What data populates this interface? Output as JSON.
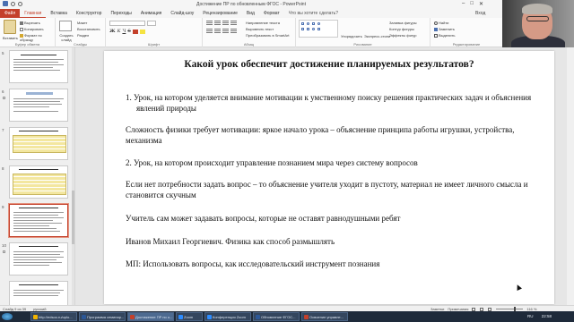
{
  "window": {
    "title": "Достижение ПР по обновленным ФГОС  -  PowerPoint",
    "controls": [
      "–",
      "□",
      "✕"
    ]
  },
  "tabs": {
    "items": [
      "Файл",
      "Главная",
      "Вставка",
      "Конструктор",
      "Переходы",
      "Анимация",
      "Слайд-шоу",
      "Рецензирование",
      "Вид",
      "Формат"
    ],
    "tell_me": "Что вы хотите сделать?",
    "login": "Вход"
  },
  "ribbon": {
    "clipboard": {
      "paste": "Вставить",
      "cut": "Вырезать",
      "copy": "Копировать",
      "format": "Формат по образцу",
      "label": "Буфер обмена"
    },
    "slides": {
      "new_slide": "Создать слайд",
      "layout": "Макет",
      "reset": "Восстановить",
      "section": "Раздел",
      "label": "Слайды"
    },
    "font": {
      "bold": "Ж",
      "italic": "К",
      "underline": "Ч",
      "strike": "S",
      "label": "Шрифт"
    },
    "paragraph": {
      "text_direction": "Направление текста",
      "align_text": "Выровнять текст",
      "smartart": "Преобразовать в SmartArt",
      "label": "Абзац"
    },
    "drawing": {
      "arrange": "Упорядочить",
      "quick_styles": "Экспресс-стили",
      "fill": "Заливка фигуры",
      "outline": "Контур фигуры",
      "effects": "Эффекты фигур",
      "label": "Рисование"
    },
    "editing": {
      "find": "Найти",
      "replace": "Заменить",
      "select": "Выделить",
      "label": "Редактирование"
    }
  },
  "thumbnails": {
    "numbers": [
      "5",
      "6",
      "7",
      "8",
      "9",
      "10"
    ],
    "selected_number": "9"
  },
  "slide": {
    "title": "Какой урок обеспечит достижение планируемых результатов?",
    "paragraphs": [
      "1.  Урок, на котором уделяется внимание мотивации к умственному поиску решения практических задач и объяснения явлений природы",
      "Сложность физики требует мотивации: яркое начало урока – объяснение принципа работы игрушки, устройства, механизма",
      "2. Урок, на котором происходит управление познанием мира через систему вопросов",
      "Если нет потребности задать вопрос – то объяснение учителя уходит в пустоту, материал не имеет личного смысла и становится скучным",
      "Учитель сам может задавать вопросы, которые не оставят равнодушными ребят",
      "Иванов Михаил Георгиевич. Физика как способ размышлять",
      "МП: Использовать вопросы, как исследовательский инструмент познания"
    ]
  },
  "statusbar": {
    "slide_counter": "Слайд 9 из 39",
    "language": "русский",
    "notes": "Заметки",
    "comments": "Примечания",
    "zoom": "116 %"
  },
  "taskbar": {
    "apps": [
      {
        "label": "http://edsoo.ru/uplo...",
        "color": "#f2b400"
      },
      {
        "label": "Программа семинар...",
        "color": "#2b5797"
      },
      {
        "label": "Достижение ПР по о...",
        "color": "#c4402b"
      },
      {
        "label": "Zoom",
        "color": "#2d8cff"
      },
      {
        "label": "Конференция Zoom",
        "color": "#2d8cff"
      },
      {
        "label": "Обновление ФГОС...",
        "color": "#2b5797"
      },
      {
        "label": "Освоение управле...",
        "color": "#c4402b"
      }
    ],
    "lang": "RU",
    "time": "22:58"
  }
}
